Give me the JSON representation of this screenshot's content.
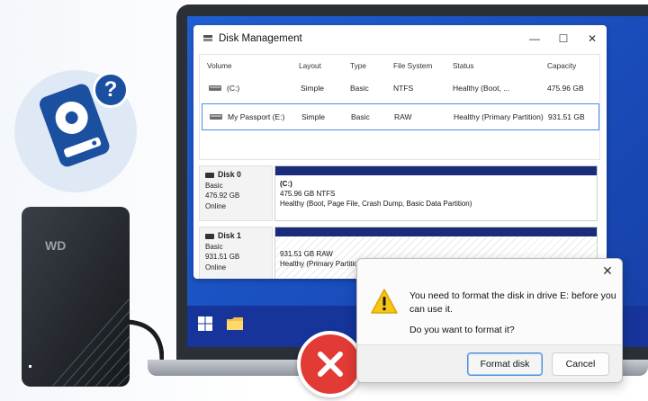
{
  "window": {
    "title": "Disk Management",
    "controls": {
      "minimize": "—",
      "maximize": "☐",
      "close": "✕"
    }
  },
  "volumes": {
    "headers": [
      "Volume",
      "Layout",
      "Type",
      "File System",
      "Status",
      "Capacity"
    ],
    "rows": [
      {
        "volume": "(C:)",
        "layout": "Simple",
        "type": "Basic",
        "fs": "NTFS",
        "status": "Healthy (Boot, ...",
        "capacity": "475.96 GB"
      },
      {
        "volume": "My Passport (E:)",
        "layout": "Simple",
        "type": "Basic",
        "fs": "RAW",
        "status": "Healthy (Primary Partition)",
        "capacity": "931.51 GB"
      }
    ]
  },
  "disks": [
    {
      "name": "Disk 0",
      "type": "Basic",
      "size": "476.92 GB",
      "state": "Online",
      "partition": {
        "label": "(C:)",
        "detail": "475.96 GB NTFS",
        "status": "Healthy (Boot, Page File, Crash Dump, Basic Data Partition)"
      }
    },
    {
      "name": "Disk 1",
      "type": "Basic",
      "size": "931.51 GB",
      "state": "Online",
      "partition": {
        "label": "",
        "detail": "931.51 GB RAW",
        "status": "Healthy (Primary Partition)"
      }
    }
  ],
  "dialog": {
    "message": "You need to format the disk in drive E: before you can use it.",
    "question": "Do you want to format it?",
    "primary_button": "Format disk",
    "secondary_button": "Cancel",
    "close_glyph": "✕"
  },
  "illustration": {
    "question_mark": "?",
    "drive_brand": "WD"
  },
  "colors": {
    "accent_blue": "#1b4fa0",
    "screen_blue": "#1f5fd1",
    "partition_band": "#1a2b7a",
    "error_red": "#e23a35",
    "warning_yellow": "#f5c518"
  }
}
